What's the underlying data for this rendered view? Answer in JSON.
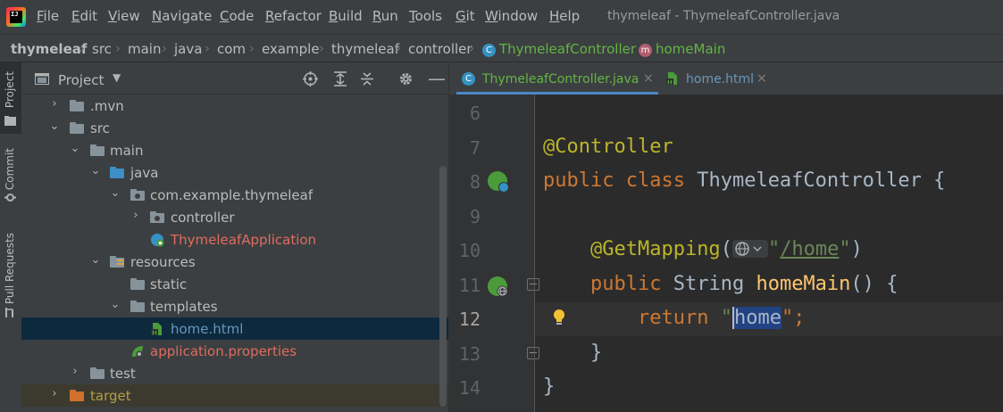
{
  "menubar": {
    "items": [
      {
        "mnemonic": "F",
        "rest": "ile"
      },
      {
        "mnemonic": "E",
        "rest": "dit"
      },
      {
        "mnemonic": "V",
        "rest": "iew"
      },
      {
        "mnemonic": "N",
        "rest": "avigate"
      },
      {
        "mnemonic": "C",
        "rest": "ode"
      },
      {
        "mnemonic": "R",
        "rest": "efactor"
      },
      {
        "mnemonic": "B",
        "rest": "uild"
      },
      {
        "mnemonic": "R",
        "rest": "un"
      },
      {
        "mnemonic": "T",
        "rest": "ools"
      },
      {
        "mnemonic": "G",
        "rest": "it"
      },
      {
        "mnemonic": "W",
        "rest": "indow"
      },
      {
        "mnemonic": "H",
        "rest": "elp"
      }
    ],
    "window_title": "thymeleaf - ThymeleafController.java",
    "logo_text": "IJ"
  },
  "breadcrumb": {
    "items": [
      "thymeleaf",
      "src",
      "main",
      "java",
      "com",
      "example",
      "thymeleaf",
      "controller"
    ],
    "class_item": "ThymeleafController",
    "class_badge": "C",
    "method_item": "homeMain",
    "method_badge": "m"
  },
  "toolstrip": {
    "project": "Project",
    "commit": "Commit",
    "pull_requests": "Pull Requests"
  },
  "project_panel": {
    "title": "Project",
    "tree": [
      {
        "label": ".mvn",
        "depth": 1,
        "arrow": "›",
        "kind": "folder"
      },
      {
        "label": "src",
        "depth": 1,
        "arrow": "⌄",
        "kind": "folder"
      },
      {
        "label": "main",
        "depth": 2,
        "arrow": "⌄",
        "kind": "folder"
      },
      {
        "label": "java",
        "depth": 3,
        "arrow": "⌄",
        "kind": "source-folder"
      },
      {
        "label": "com.example.thymeleaf",
        "depth": 4,
        "arrow": "⌄",
        "kind": "package"
      },
      {
        "label": "controller",
        "depth": 5,
        "arrow": "›",
        "kind": "package"
      },
      {
        "label": "ThymeleafApplication",
        "depth": 5,
        "arrow": "",
        "kind": "spring-app"
      },
      {
        "label": "resources",
        "depth": 3,
        "arrow": "⌄",
        "kind": "resources"
      },
      {
        "label": "static",
        "depth": 4,
        "arrow": "",
        "kind": "folder"
      },
      {
        "label": "templates",
        "depth": 4,
        "arrow": "⌄",
        "kind": "folder"
      },
      {
        "label": "home.html",
        "depth": 5,
        "arrow": "",
        "kind": "html"
      },
      {
        "label": "application.properties",
        "depth": 4,
        "arrow": "",
        "kind": "properties"
      },
      {
        "label": "test",
        "depth": 2,
        "arrow": "›",
        "kind": "folder"
      },
      {
        "label": "target",
        "depth": 1,
        "arrow": "›",
        "kind": "excluded"
      }
    ]
  },
  "editor": {
    "tabs": [
      {
        "label": "ThymeleafController.java",
        "badge": "C",
        "close": "×",
        "active": true
      },
      {
        "label": "home.html",
        "badge": "H",
        "close": "×",
        "active": false
      }
    ],
    "line_numbers": [
      "6",
      "7",
      "8",
      "9",
      "10",
      "11",
      "12",
      "13",
      "14"
    ],
    "code": {
      "l7_annotation": "@Controller",
      "l8_public": "public",
      "l8_class": "class",
      "l8_name": "ThymeleafController",
      "l8_brace": "{",
      "l10_annotation": "@GetMapping",
      "l10_paren_open": "(",
      "l10_quote_open": "\"",
      "l10_path": "/home",
      "l10_quote_close": "\"",
      "l10_paren_close": ")",
      "l11_public": "public",
      "l11_type": "String",
      "l11_method": "homeMain",
      "l11_rest": "() {",
      "l12_return": "return",
      "l12_quote_open": "\"",
      "l12_value": "home",
      "l12_end": "\";",
      "l13_brace": "}",
      "l14_brace": "}"
    }
  },
  "colors": {
    "keyword": "#cc7832",
    "annotation": "#bbb529",
    "string": "#6a8759",
    "method": "#ffc66d",
    "spring_green": "#4b9b3b"
  }
}
